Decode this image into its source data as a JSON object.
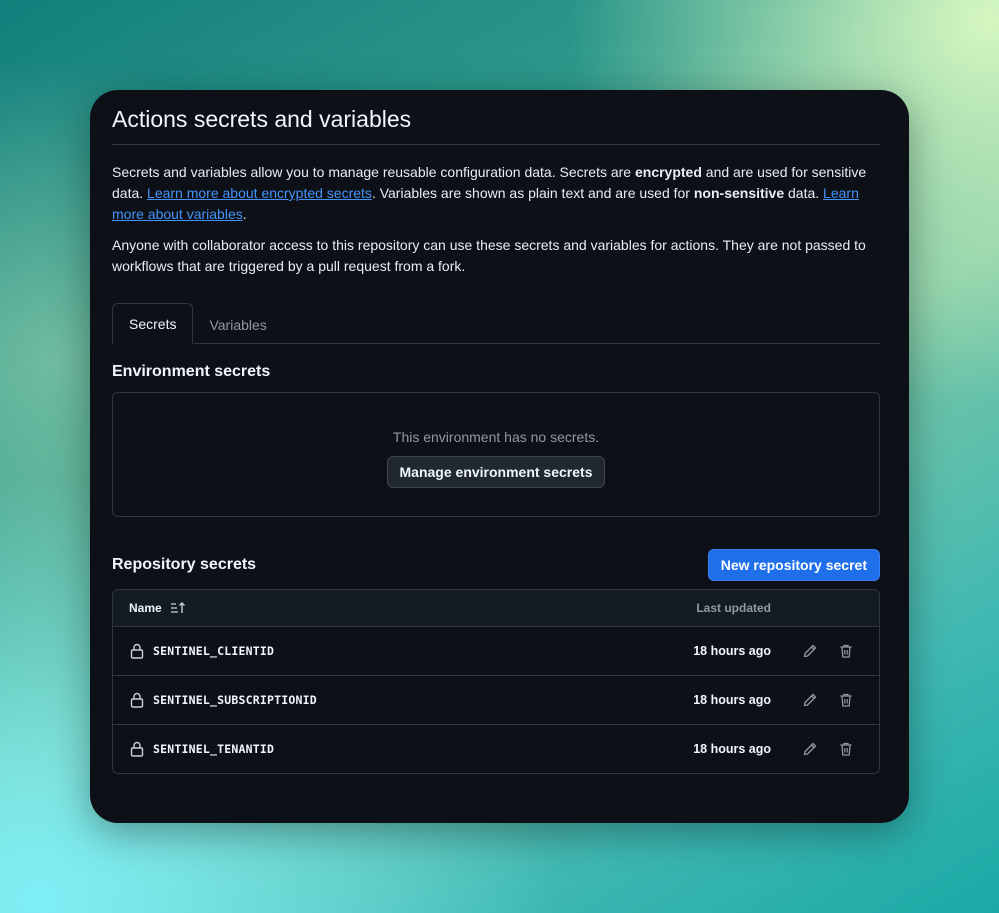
{
  "page": {
    "title": "Actions secrets and variables",
    "intro": {
      "part1": "Secrets and variables allow you to manage reusable configuration data. Secrets are ",
      "bold1": "encrypted",
      "part2": " and are used for sensitive data. ",
      "link1": "Learn more about encrypted secrets",
      "part3": ". Variables are shown as plain text and are used for ",
      "bold2": "non-sensitive",
      "part4": " data. ",
      "link2": "Learn more about variables",
      "part5": "."
    },
    "notice": "Anyone with collaborator access to this repository can use these secrets and variables for actions. They are not passed to workflows that are triggered by a pull request from a fork."
  },
  "tabs": [
    {
      "label": "Secrets",
      "active": true
    },
    {
      "label": "Variables",
      "active": false
    }
  ],
  "environment": {
    "heading": "Environment secrets",
    "empty_text": "This environment has no secrets.",
    "manage_button": "Manage environment secrets"
  },
  "repository": {
    "heading": "Repository secrets",
    "new_button": "New repository secret",
    "columns": {
      "name": "Name",
      "updated": "Last updated"
    },
    "sort_icon": "sort-ascending-icon",
    "rows": [
      {
        "name": "SENTINEL_CLIENTID",
        "updated": "18 hours ago"
      },
      {
        "name": "SENTINEL_SUBSCRIPTIONID",
        "updated": "18 hours ago"
      },
      {
        "name": "SENTINEL_TENANTID",
        "updated": "18 hours ago"
      }
    ],
    "row_icons": {
      "lead": "lock-icon",
      "edit": "pencil-icon",
      "delete": "trash-icon"
    }
  },
  "colors": {
    "background": "#0d1117",
    "accent": "#1f6feb",
    "link": "#4493f8",
    "border": "#30363d"
  }
}
